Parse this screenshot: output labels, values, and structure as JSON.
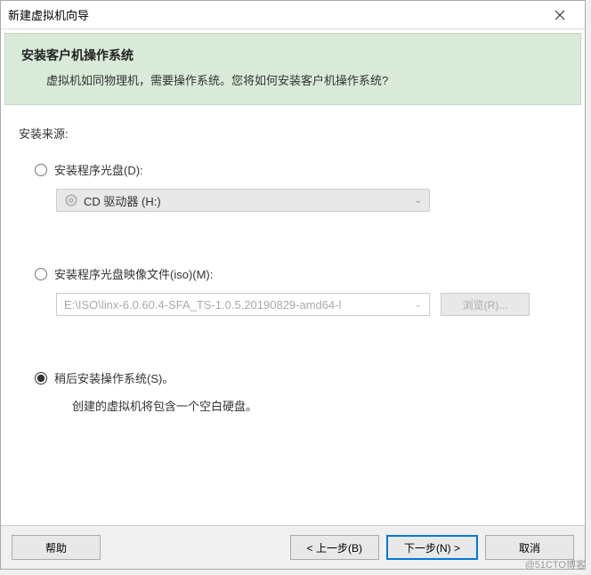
{
  "window": {
    "title": "新建虚拟机向导"
  },
  "header": {
    "title": "安装客户机操作系统",
    "subtitle": "虚拟机如同物理机，需要操作系统。您将如何安装客户机操作系统?"
  },
  "source": {
    "label": "安装来源:",
    "disc": {
      "label": "安装程序光盘(D):",
      "value": "CD 驱动器 (H:)"
    },
    "iso": {
      "label": "安装程序光盘映像文件(iso)(M):",
      "value": "E:\\ISO\\linx-6.0.60.4-SFA_TS-1.0.5.20190829-amd64-l",
      "browse": "浏览(R)..."
    },
    "later": {
      "label": "稍后安装操作系统(S)。",
      "desc": "创建的虚拟机将包含一个空白硬盘。"
    }
  },
  "footer": {
    "help": "帮助",
    "back": "< 上一步(B)",
    "next": "下一步(N) >",
    "cancel": "取消"
  },
  "watermark": "@51CTO博客"
}
